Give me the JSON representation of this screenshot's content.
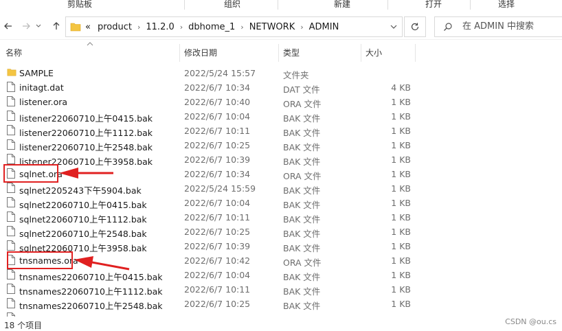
{
  "ribbon": {
    "groups": [
      "剪贴板",
      "组织",
      "新建",
      "打开",
      "选择"
    ]
  },
  "nav": {
    "breadcrumbs": [
      "«",
      "product",
      "11.2.0",
      "dbhome_1",
      "NETWORK",
      "ADMIN"
    ],
    "search_placeholder": "在 ADMIN 中搜索"
  },
  "columns": {
    "name": "名称",
    "date": "修改日期",
    "type": "类型",
    "size": "大小"
  },
  "files": [
    {
      "name": "SAMPLE",
      "date": "2022/5/24 15:57",
      "type": "文件夹",
      "size": "",
      "icon": "folder-icon"
    },
    {
      "name": "initagt.dat",
      "date": "2022/6/7 10:34",
      "type": "DAT 文件",
      "size": "4 KB",
      "icon": "file-icon"
    },
    {
      "name": "listener.ora",
      "date": "2022/6/7 10:40",
      "type": "ORA 文件",
      "size": "1 KB",
      "icon": "file-icon"
    },
    {
      "name": "listener22060710上午0415.bak",
      "date": "2022/6/7 10:04",
      "type": "BAK 文件",
      "size": "1 KB",
      "icon": "file-icon"
    },
    {
      "name": "listener22060710上午1112.bak",
      "date": "2022/6/7 10:11",
      "type": "BAK 文件",
      "size": "1 KB",
      "icon": "file-icon"
    },
    {
      "name": "listener22060710上午2548.bak",
      "date": "2022/6/7 10:25",
      "type": "BAK 文件",
      "size": "1 KB",
      "icon": "file-icon"
    },
    {
      "name": "listener22060710上午3958.bak",
      "date": "2022/6/7 10:39",
      "type": "BAK 文件",
      "size": "1 KB",
      "icon": "file-icon"
    },
    {
      "name": "sqlnet.ora",
      "date": "2022/6/7 10:34",
      "type": "ORA 文件",
      "size": "1 KB",
      "icon": "file-icon"
    },
    {
      "name": "sqlnet2205243下午5904.bak",
      "date": "2022/5/24 15:59",
      "type": "BAK 文件",
      "size": "1 KB",
      "icon": "file-icon"
    },
    {
      "name": "sqlnet22060710上午0415.bak",
      "date": "2022/6/7 10:04",
      "type": "BAK 文件",
      "size": "1 KB",
      "icon": "file-icon"
    },
    {
      "name": "sqlnet22060710上午1112.bak",
      "date": "2022/6/7 10:11",
      "type": "BAK 文件",
      "size": "1 KB",
      "icon": "file-icon"
    },
    {
      "name": "sqlnet22060710上午2548.bak",
      "date": "2022/6/7 10:25",
      "type": "BAK 文件",
      "size": "1 KB",
      "icon": "file-icon"
    },
    {
      "name": "sqlnet22060710上午3958.bak",
      "date": "2022/6/7 10:39",
      "type": "BAK 文件",
      "size": "1 KB",
      "icon": "file-icon"
    },
    {
      "name": "tnsnames.ora",
      "date": "2022/6/7 10:42",
      "type": "ORA 文件",
      "size": "1 KB",
      "icon": "file-icon"
    },
    {
      "name": "tnsnames22060710上午0415.bak",
      "date": "2022/6/7 10:04",
      "type": "BAK 文件",
      "size": "1 KB",
      "icon": "file-icon"
    },
    {
      "name": "tnsnames22060710上午1112.bak",
      "date": "2022/6/7 10:11",
      "type": "BAK 文件",
      "size": "1 KB",
      "icon": "file-icon"
    },
    {
      "name": "tnsnames22060710上午2548.bak",
      "date": "2022/6/7 10:25",
      "type": "BAK 文件",
      "size": "1 KB",
      "icon": "file-icon"
    }
  ],
  "status": {
    "item_count": "18 个项目",
    "watermark": "CSDN @ou.cs"
  },
  "colors": {
    "annotation": "#e02020",
    "folder": "#f4c542"
  }
}
